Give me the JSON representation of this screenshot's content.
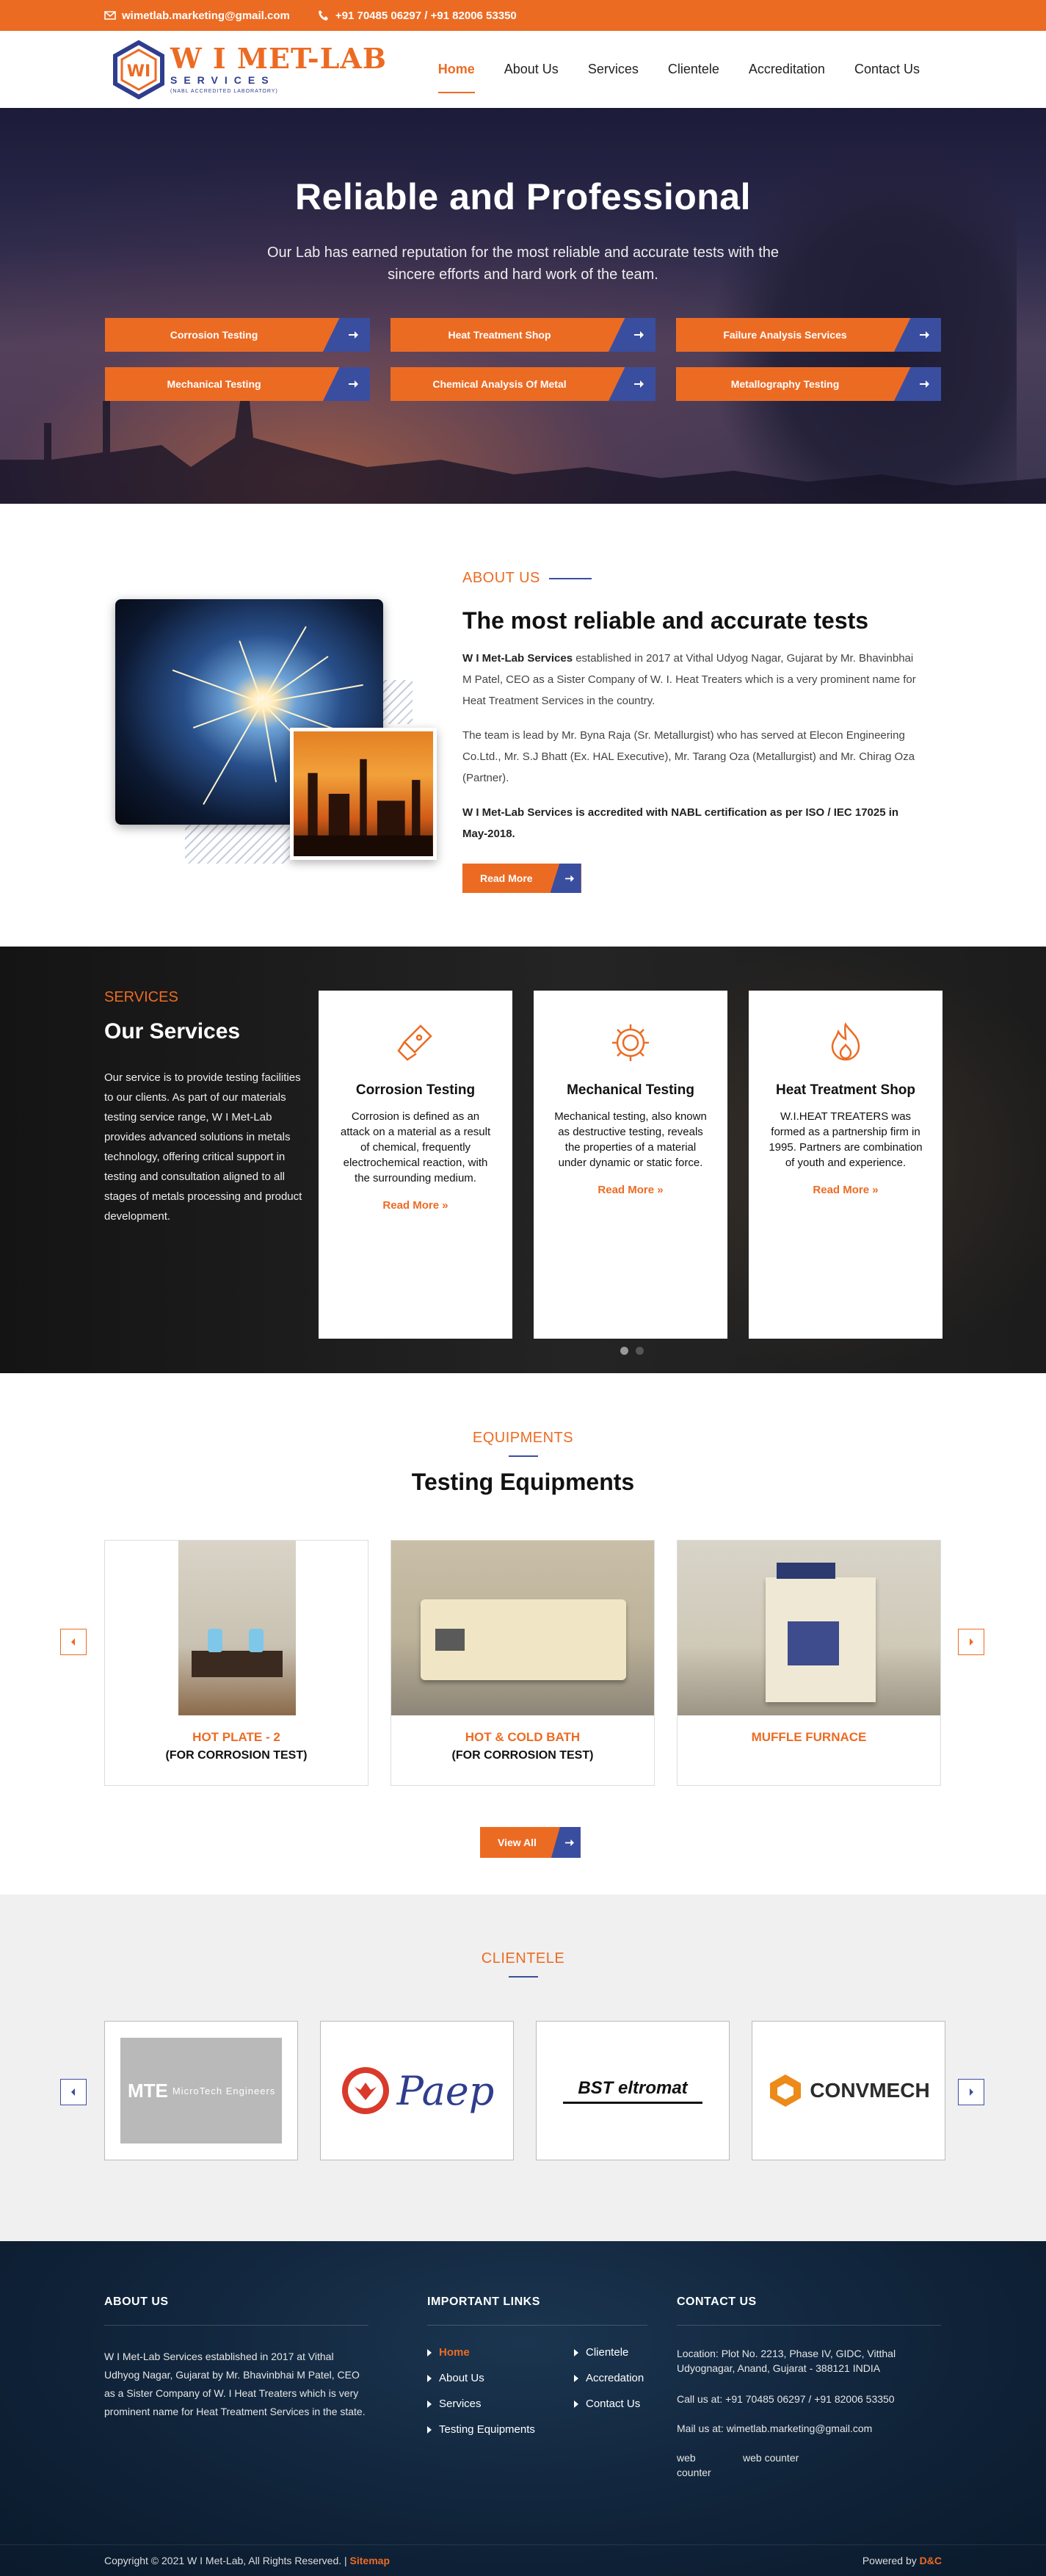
{
  "topbar": {
    "email": "wimetlab.marketing@gmail.com",
    "phone": "+91 70485 06297 / +91 82006 53350"
  },
  "brand": {
    "title": "W I MET-LAB",
    "subtitle": "SERVICES",
    "tagline": "(NABL ACCREDITED LABORATORY)",
    "monogram": "WI"
  },
  "nav": {
    "items": [
      "Home",
      "About Us",
      "Services",
      "Clientele",
      "Accreditation",
      "Contact Us"
    ]
  },
  "hero": {
    "title": "Reliable and Professional",
    "text": "Our Lab has earned reputation for the most reliable and accurate tests with the sincere efforts and hard work of the team.",
    "buttons": [
      "Corrosion Testing",
      "Heat Treatment Shop",
      "Failure Analysis Services",
      "Mechanical Testing",
      "Chemical Analysis Of Metal",
      "Metallography Testing"
    ]
  },
  "about": {
    "kicker": "ABOUT US",
    "title": "The most reliable and accurate tests",
    "p1_strong": "W I Met-Lab Services",
    "p1_rest": " established in 2017 at Vithal Udyog Nagar, Gujarat by Mr. Bhavinbhai M Patel, CEO as a Sister Company of W. I. Heat Treaters which is a very prominent name for Heat Treatment Services in the country.",
    "p2": "The team is lead by Mr. Byna Raja (Sr. Metallurgist) who has served at Elecon Engineering Co.Ltd., Mr. S.J Bhatt (Ex. HAL Executive), Mr. Tarang Oza (Metallurgist) and Mr. Chirag Oza (Partner).",
    "p3": "W I Met-Lab Services is accredited with NABL certification as per ISO / IEC 17025 in May-2018.",
    "button": "Read More"
  },
  "services": {
    "kicker": "SERVICES",
    "title": "Our Services",
    "text": "Our service is to provide testing facilities to our clients. As part of our materials testing service range, W I Met-Lab provides advanced solutions in metals technology, offering critical support in testing and consultation aligned to all stages of metals processing and product development.",
    "cards": [
      {
        "title": "Corrosion Testing",
        "text": "Corrosion is defined as an attack on a material as a result of chemical, frequently electrochemical reaction, with the surrounding medium.",
        "more": "Read More »",
        "icon": "corrosion-icon"
      },
      {
        "title": "Mechanical Testing",
        "text": "Mechanical testing, also known as destructive testing, reveals the properties of a material under dynamic or static force.",
        "more": "Read More »",
        "icon": "gear-icon"
      },
      {
        "title": "Heat Treatment Shop",
        "text": "W.I.HEAT TREATERS was formed as a partnership firm in 1995. Partners are combination of youth and experience.",
        "more": "Read More »",
        "icon": "flame-icon"
      }
    ]
  },
  "equipments": {
    "kicker": "EQUIPMENTS",
    "title": "Testing Equipments",
    "items": [
      {
        "title": "HOT PLATE - 2",
        "sub": "(FOR CORROSION TEST)"
      },
      {
        "title": "HOT & COLD BATH",
        "sub": "(FOR CORROSION TEST)"
      },
      {
        "title": "MUFFLE FURNACE",
        "sub": ""
      }
    ],
    "button": "View All"
  },
  "clientele": {
    "kicker": "CLIENTELE",
    "logos": [
      {
        "name": "MicroTech Engineers",
        "mark": "MTE"
      },
      {
        "name": "Paep",
        "mark": "Paep"
      },
      {
        "name": "BST eltromat",
        "mark": "BST eltromat"
      },
      {
        "name": "CONVMECH",
        "mark": "CONVMECH"
      }
    ]
  },
  "footer": {
    "about_title": "ABOUT US",
    "about_text": "W I Met-Lab Services established in 2017 at Vithal Udhyog Nagar, Gujarat by Mr. Bhavinbhai M Patel, CEO as a Sister Company of W. I Heat Treaters which is very prominent name for Heat Treatment Services in the state.",
    "links_title": "IMPORTANT LINKS",
    "links": [
      "Home",
      "Clientele",
      "About Us",
      "Accredation",
      "Services",
      "Contact Us",
      "Testing Equipments"
    ],
    "contact_title": "CONTACT US",
    "location": "Location: Plot No. 2213, Phase IV, GIDC, Vitthal Udyognagar, Anand, Gujarat - 388121 INDIA",
    "call": "Call us at: +91 70485 06297 / +91 82006 53350",
    "mail": "Mail us at: wimetlab.marketing@gmail.com",
    "counter1": "web counter",
    "counter2": "web counter",
    "copyright": "Copyright © 2021 W I Met-Lab, All Rights Reserved. | ",
    "sitemap": "Sitemap",
    "powered": "Powered by ",
    "powered_by": "D&C"
  },
  "colors": {
    "accent": "#ec6b23",
    "secondary": "#3a4ea0",
    "footer_bg": "#0f2238"
  }
}
